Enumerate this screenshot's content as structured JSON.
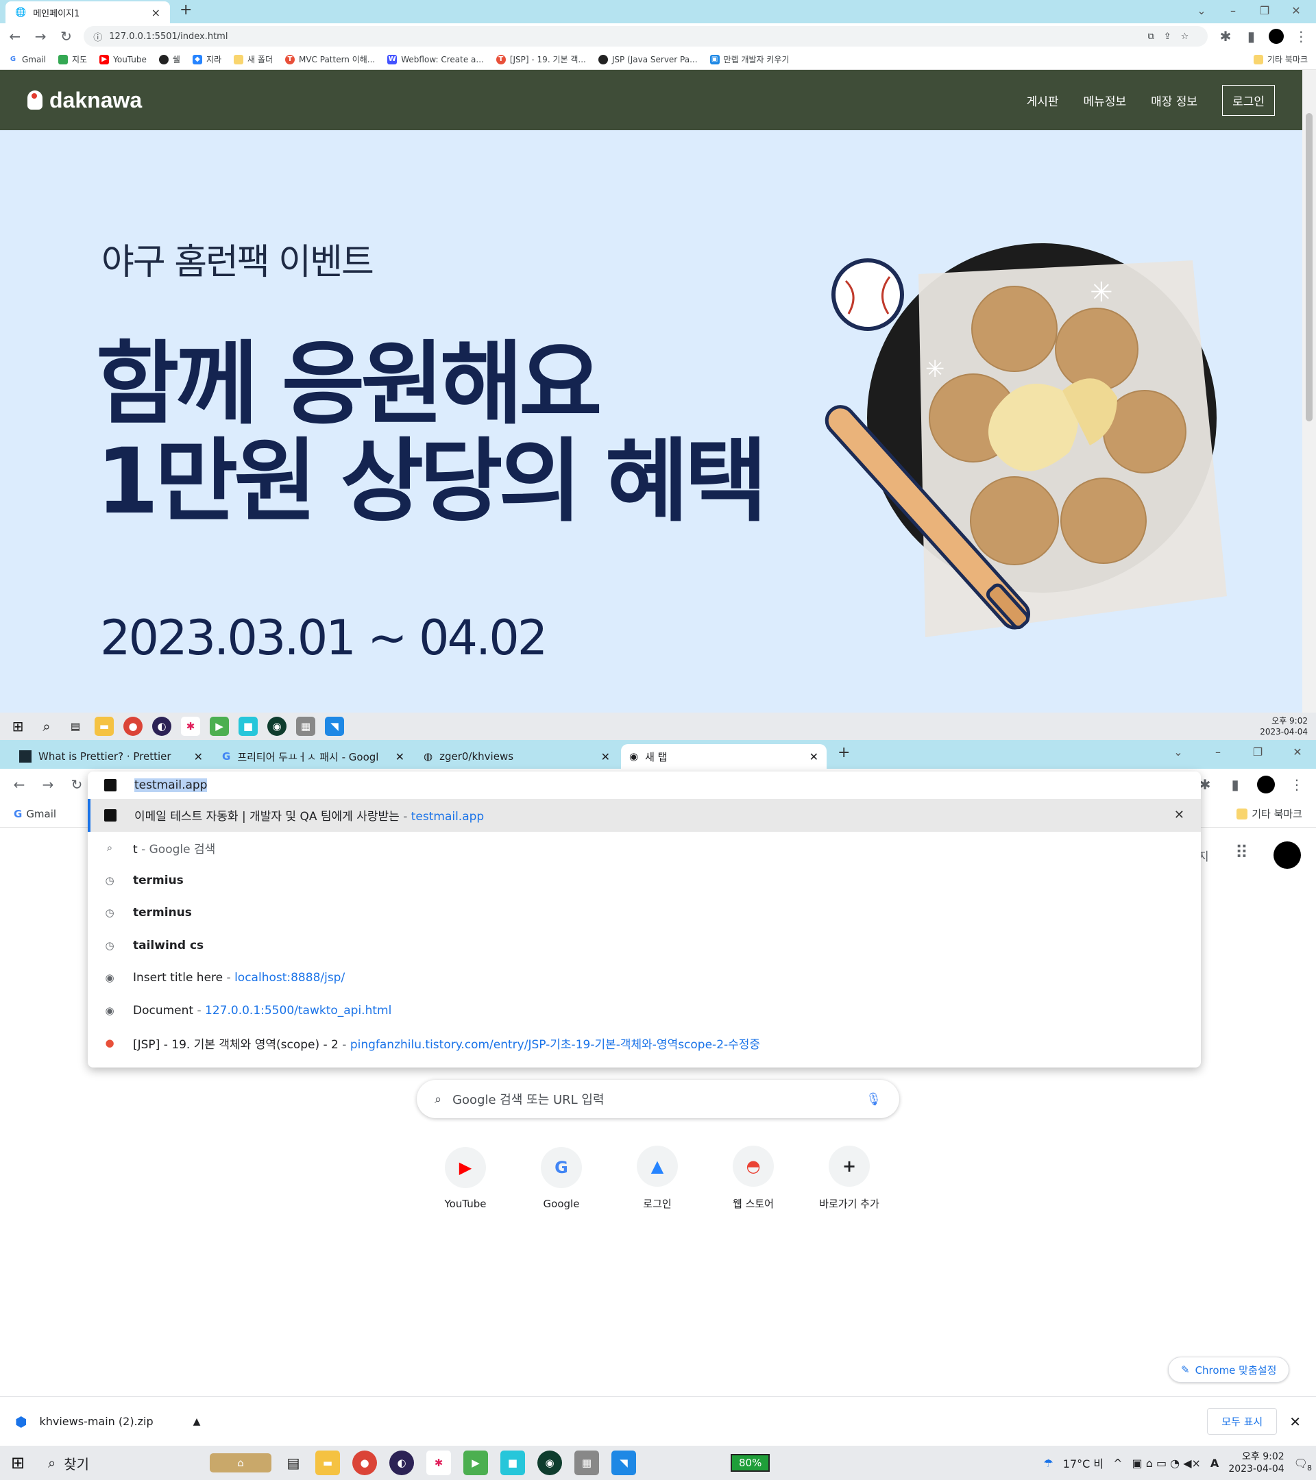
{
  "top_browser": {
    "tab_title": "메인페이지1",
    "url": "127.0.0.1:5501/index.html",
    "bookmarks": [
      "Gmail",
      "지도",
      "YouTube",
      "쉘",
      "지라",
      "새 폴더",
      "MVC Pattern 이해...",
      "Webflow: Create a...",
      "[JSP] - 19. 기본 객...",
      "JSP (Java Server Pa...",
      "만렙 개발자 키우기"
    ],
    "other_bookmarks": "기타 북마크"
  },
  "site": {
    "logo": "daknawa",
    "nav": [
      "게시판",
      "메뉴정보",
      "매장 정보"
    ],
    "login": "로그인",
    "hero_subtitle": "야구 홈런팩 이벤트",
    "hero_title_line1": "함께 응원해요",
    "hero_title_line2": "1만원 상당의 혜택",
    "hero_date": "2023.03.01 ~ 04.02"
  },
  "mid_clock": {
    "time": "오후 9:02",
    "date": "2023-04-04"
  },
  "bottom_browser": {
    "tabs": [
      "What is Prettier? · Prettier",
      "프리티어 두ㅛㅓㅅ 패시 - Googl",
      "zger0/khviews",
      "새 탭"
    ],
    "omnibox_text": "testmail.app",
    "bookmark_gmail": "Gmail",
    "other_bookmarks": "기타 북마크",
    "suggestions": [
      {
        "text": "이메일 테스트 자동화 | 개발자 및 QA 팀에게 사랑받는",
        "url": "testmail.app",
        "icon": "site-icon"
      },
      {
        "text": "t",
        "url": "Google 검색",
        "icon": "search-icon"
      },
      {
        "text": "termius",
        "url": "",
        "icon": "history-icon"
      },
      {
        "text": "terminus",
        "url": "",
        "icon": "history-icon"
      },
      {
        "text": "tailwind cs",
        "url": "",
        "icon": "history-icon"
      },
      {
        "text": "Insert title here",
        "url": "localhost:8888/jsp/",
        "icon": "globe-icon"
      },
      {
        "text": "Document",
        "url": "127.0.0.1:5500/tawkto_api.html",
        "icon": "globe-icon"
      },
      {
        "text": "[JSP] - 19. 기본 객체와 영역(scope) - 2",
        "url": "pingfanzhilu.tistory.com/entry/JSP-기초-19-기본-객체와-영역scope-2-수정중",
        "icon": "tistory-icon"
      }
    ],
    "search_placeholder": "Google 검색 또는 URL 입력",
    "shortcuts": [
      "YouTube",
      "Google",
      "로그인",
      "웹 스토어",
      "바로가기 추가"
    ],
    "customize": "Chrome 맞춤설정",
    "partial_right": "지"
  },
  "download": {
    "file": "khviews-main (2).zip",
    "show_all": "모두 표시"
  },
  "taskbar": {
    "search": "찾기",
    "battery": "80%",
    "weather": "17°C 비",
    "time": "오후 9:02",
    "date": "2023-04-04",
    "notifications": "8"
  },
  "colors": {
    "header": "#3f4d38",
    "hero_bg": "#dcecfd",
    "hero_text": "#142450",
    "tab_strip": "#b5e3f0",
    "accent": "#1a73e8"
  }
}
